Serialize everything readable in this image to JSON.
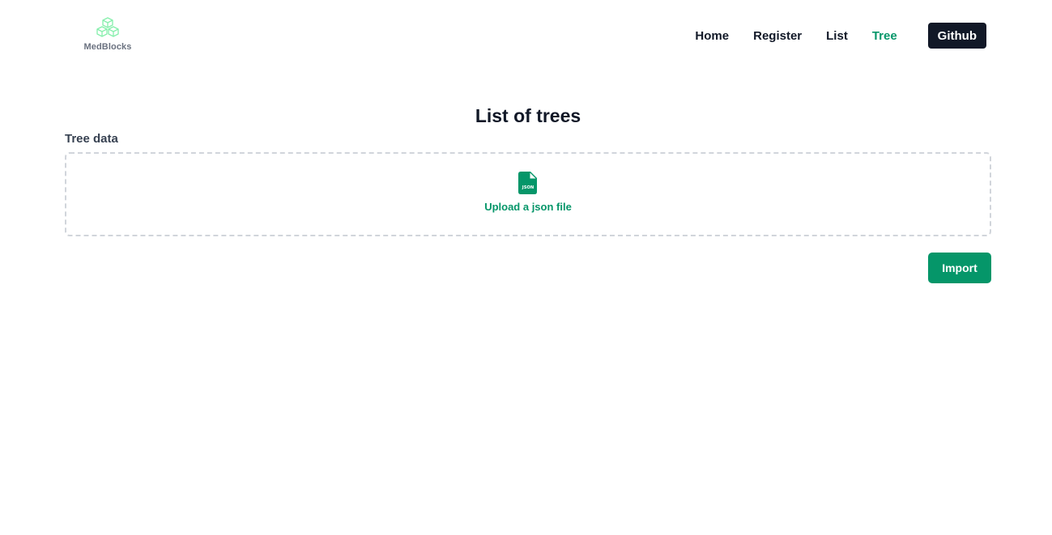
{
  "logo": {
    "text": "MedBlocks",
    "icon": "cubes-logo-icon"
  },
  "nav": {
    "links": [
      {
        "label": "Home",
        "active": false
      },
      {
        "label": "Register",
        "active": false
      },
      {
        "label": "List",
        "active": false
      },
      {
        "label": "Tree",
        "active": true
      }
    ],
    "github_label": "Github"
  },
  "main": {
    "title": "List of trees",
    "field_label": "Tree data",
    "upload": {
      "icon": "json-file-icon",
      "icon_text": "JSON",
      "label": "Upload a json file"
    },
    "import_label": "Import"
  },
  "colors": {
    "accent": "#059669",
    "dark": "#111827",
    "logo_green": "#86efac"
  }
}
